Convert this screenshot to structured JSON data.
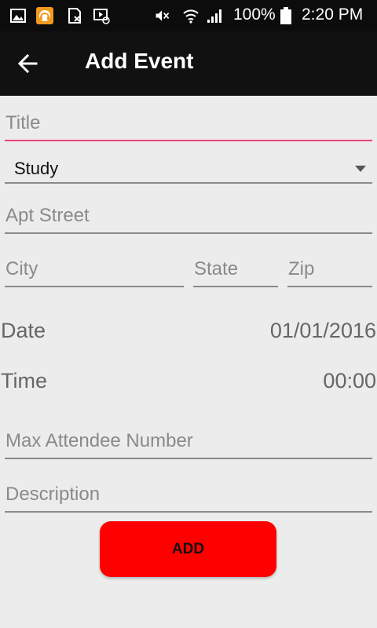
{
  "status_bar": {
    "battery_percent": "100%",
    "time": "2:20 PM",
    "icons": [
      "image-icon",
      "headphones-app-icon",
      "sim-blocked-icon",
      "media-icon",
      "mute-icon",
      "wifi-icon",
      "signal-icon",
      "battery-icon"
    ]
  },
  "app_bar": {
    "title": "Add Event",
    "back_icon": "arrow-left-icon"
  },
  "form": {
    "title_placeholder": "Title",
    "category_value": "Study",
    "street_placeholder": "Apt Street",
    "city_placeholder": "City",
    "state_placeholder": "State",
    "zip_placeholder": "Zip",
    "date_label": "Date",
    "date_value": "01/01/2016",
    "time_label": "Time",
    "time_value": "00:00",
    "max_attendee_placeholder": "Max Attendee Number",
    "description_placeholder": "Description",
    "add_label": "ADD"
  },
  "colors": {
    "focus_underline": "#e8437e",
    "add_button": "#ff0000",
    "app_bar": "#111111"
  }
}
